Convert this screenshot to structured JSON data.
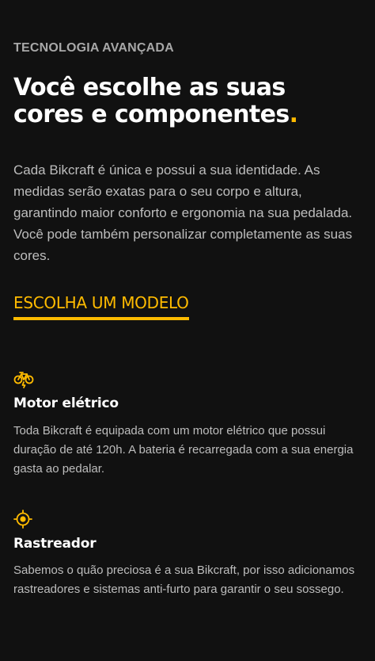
{
  "section": {
    "eyebrow": "TECNOLOGIA AVANÇADA",
    "title_line1": "Você escolhe as suas",
    "title_line2": "cores e componentes",
    "title_dot": ".",
    "lead": "Cada Bikcraft é única e possui a sua identidade. As medidas serão exatas para o seu corpo e altura, garantindo maior conforto e ergonomia na sua pedalada. Você pode também personalizar completamente as suas cores.",
    "cta_label": "ESCOLHA UM MODELO"
  },
  "features": [
    {
      "icon": "electric-bike-icon",
      "title": "Motor elétrico",
      "text": "Toda Bikcraft é equipada com um motor elétrico que possui duração de até 120h. A bateria é recarregada com a sua energia gasta ao pedalar."
    },
    {
      "icon": "tracker-target-icon",
      "title": "Rastreador",
      "text": "Sabemos o quão preciosa é a sua Bikcraft, por isso adicionamos rastreadores e sistemas anti-furto para garantir o seu sossego."
    }
  ],
  "colors": {
    "background": "#111111",
    "accent": "#ffbb00",
    "muted_text": "#bdbdbd",
    "eyebrow": "#a8a8a8"
  }
}
